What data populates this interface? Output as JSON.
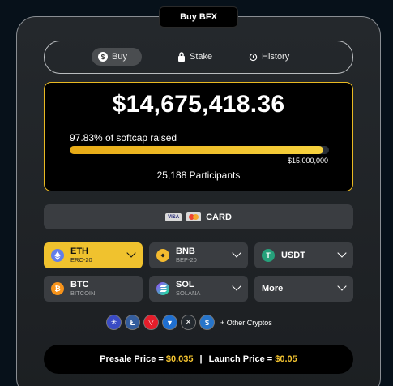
{
  "header": {
    "tab_label": "Buy BFX"
  },
  "nav": {
    "buy_label": "Buy",
    "stake_label": "Stake",
    "history_label": "History"
  },
  "raised": {
    "amount": "$14,675,418.36",
    "softcap_text": "97.83% of softcap raised",
    "progress_fraction": 0.9783,
    "goal": "$15,000,000",
    "participants": "25,188 Participants"
  },
  "card": {
    "label": "CARD",
    "visa_label": "VISA"
  },
  "coins": [
    {
      "name": "ETH",
      "network": "ERC-20",
      "icon": "ethereum-icon",
      "color": "#627eea"
    },
    {
      "name": "BNB",
      "network": "BEP-20",
      "icon": "bnb-icon",
      "color": "#f3ba2f"
    },
    {
      "name": "USDT",
      "network": "",
      "icon": "tether-icon",
      "color": "#26a17b"
    },
    {
      "name": "BTC",
      "network": "BITCOIN",
      "icon": "bitcoin-icon",
      "color": "#f7931a"
    },
    {
      "name": "SOL",
      "network": "SOLANA",
      "icon": "solana-icon",
      "color": "#9945ff"
    },
    {
      "name": "More",
      "network": "",
      "icon": "",
      "color": ""
    }
  ],
  "other_cryptos": {
    "label": "+ Other Cryptos",
    "icons": [
      "cardano-icon",
      "litecoin-icon",
      "tron-icon",
      "shiba-icon",
      "xrp-icon",
      "usdc-icon"
    ]
  },
  "price": {
    "presale_label": "Presale Price =",
    "presale_value": "$0.035",
    "separator": "|",
    "launch_label": "Launch Price =",
    "launch_value": "$0.05"
  },
  "colors": {
    "accent": "#f0c22e",
    "border_gold": "#e9b922"
  }
}
